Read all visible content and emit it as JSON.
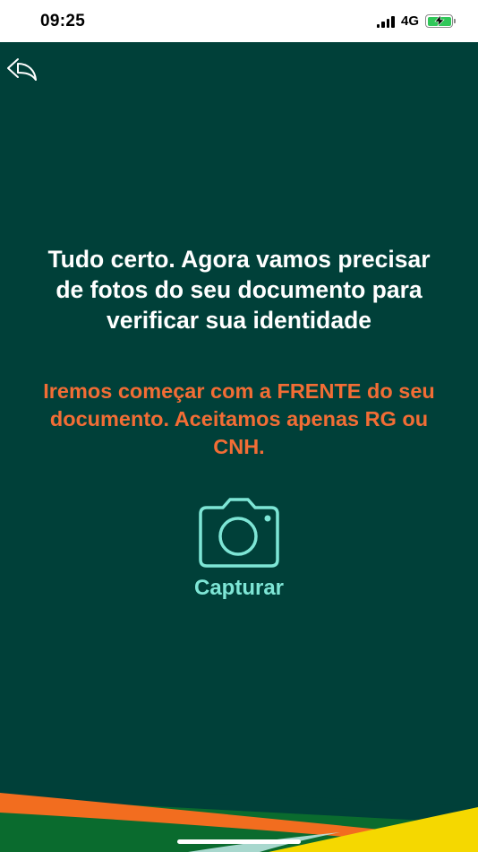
{
  "status_bar": {
    "time": "09:25",
    "network": "4G",
    "icons": [
      "signal-icon",
      "battery-charging-icon"
    ]
  },
  "nav": {
    "back_icon": "back-arrow-icon"
  },
  "content": {
    "headline": "Tudo certo. Agora vamos precisar de fotos do seu documento para verificar sua identidade",
    "subline": "Iremos começar com a FRENTE do seu documento. Aceitamos apenas RG ou CNH."
  },
  "capture": {
    "icon": "camera-icon",
    "label": "Capturar"
  },
  "colors": {
    "background": "#004039",
    "headline": "#ffffff",
    "subline": "#f26d35",
    "accent": "#7ee6d6",
    "deco_green": "#0a6b2e",
    "deco_orange": "#f26d1f",
    "deco_yellow": "#f5d800"
  }
}
